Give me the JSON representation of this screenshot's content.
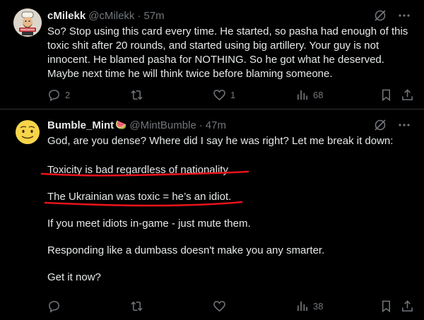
{
  "tweets": [
    {
      "name": "cMilekk",
      "handle": "@cMilekk",
      "time": "57m",
      "avatar_icon": "cartoon-chef-avatar",
      "paragraphs": [
        "So? Stop using this card every time. He started, so pasha had enough of this toxic shit after 20 rounds, and started using big artillery. Your guy is not innocent. He blamed pasha for NOTHING. So he got what he deserved. Maybe next time he will think twice before blaming someone."
      ],
      "replies": "2",
      "reposts": "",
      "likes": "1",
      "views": "68"
    },
    {
      "name": "Bumble_Mint",
      "name_emoji": "🍉",
      "handle": "@MintBumble",
      "time": "47m",
      "avatar_icon": "smiley-face-avatar",
      "paragraphs": [
        "God, are you dense? Where did I say he was right? Let me break it down:",
        "Toxicity is bad regardless of nationality.",
        "The Ukrainian was toxic = he’s an idiot.",
        "If you meet idiots in-game - just mute them.",
        "Responding like a dumbass doesn't make you any smarter.",
        "Get it now?"
      ],
      "replies": "",
      "reposts": "",
      "likes": "",
      "views": "38"
    }
  ],
  "colors": {
    "background": "#000000",
    "text": "#e7e9ea",
    "muted": "#71767b",
    "separator": "#2f3336",
    "annotation_red": "#e8131b"
  }
}
